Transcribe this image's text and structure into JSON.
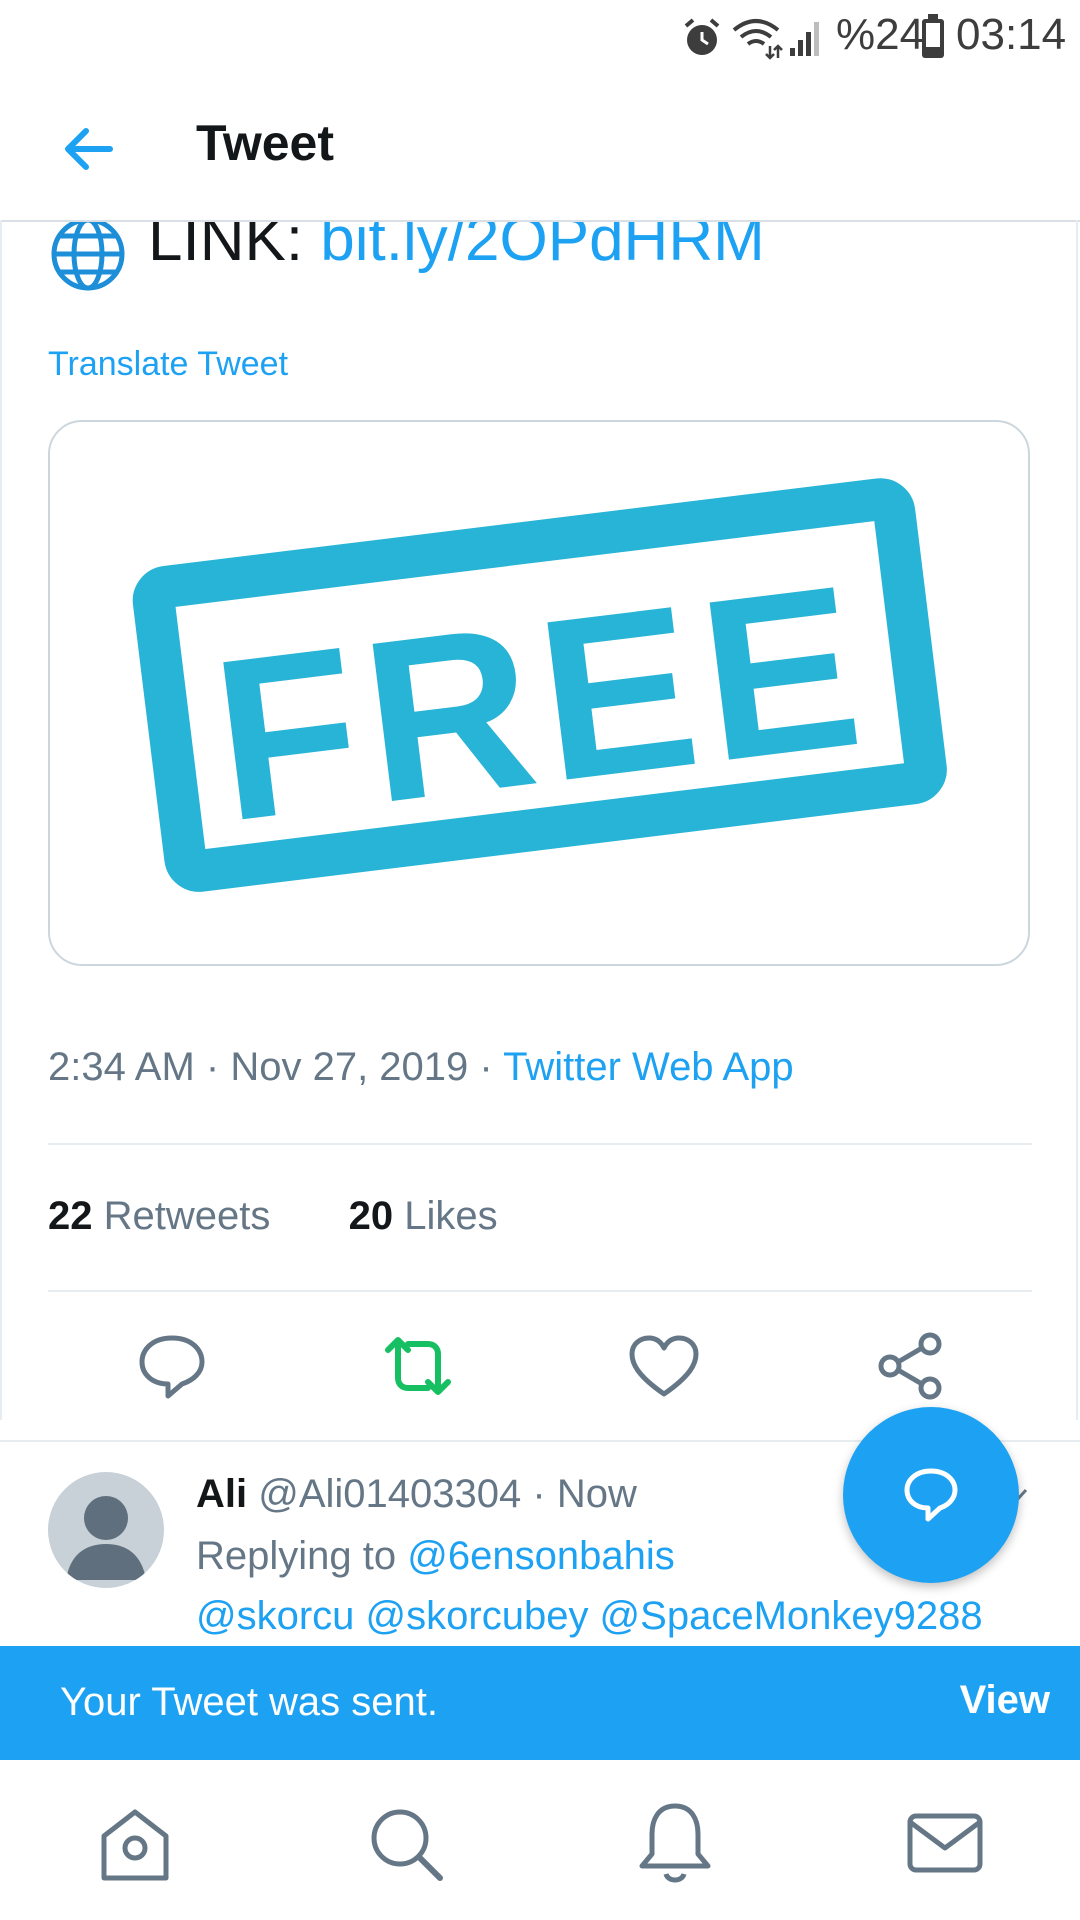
{
  "status_bar": {
    "battery": "%24",
    "time": "03:14"
  },
  "header": {
    "title": "Tweet"
  },
  "tweet": {
    "link_prefix": "LINK:",
    "link_url": "bit.ly/2OPdHRM",
    "translate_label": "Translate Tweet",
    "media_text": "FREE",
    "time": "2:34 AM",
    "date": "Nov 27, 2019",
    "source": "Twitter Web App",
    "retweets_count": "22",
    "retweets_label": "Retweets",
    "likes_count": "20",
    "likes_label": "Likes"
  },
  "reply": {
    "author_name": "Ali",
    "author_handle": "@Ali01403304",
    "time": "Now",
    "replying_to_label": "Replying to",
    "replying_to_handle": "@6ensonbahis",
    "mentions": "@skorcu @skorcubey @SpaceMonkey9288"
  },
  "toast": {
    "message": "Your Tweet was sent.",
    "action_label": "View"
  },
  "colors": {
    "accent": "#1da1f2",
    "retweet_green": "#17bf63",
    "stamp_blue": "#27b4d6"
  }
}
